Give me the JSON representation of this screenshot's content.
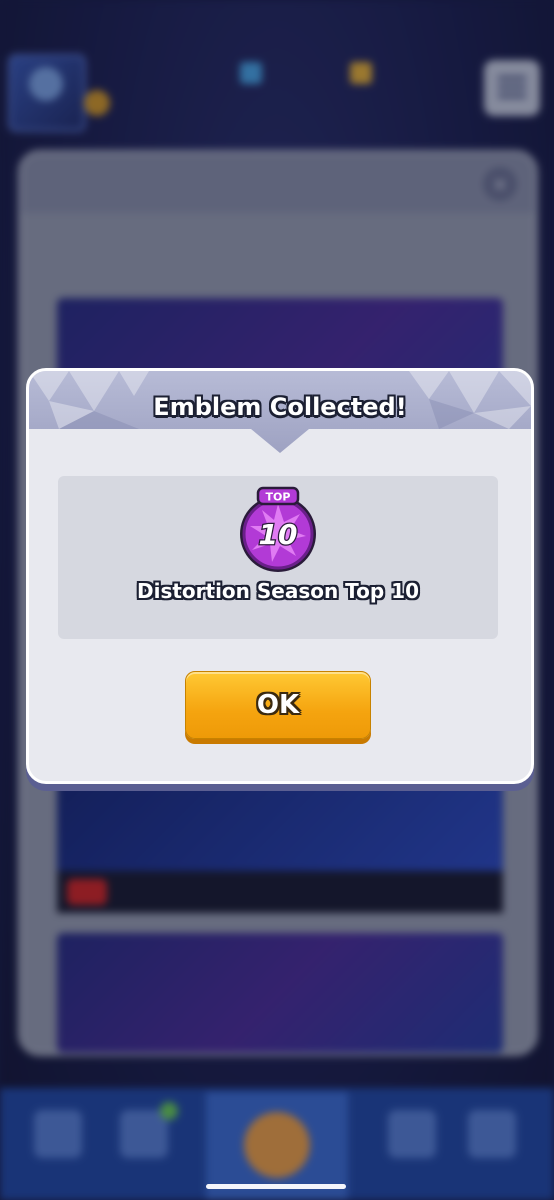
{
  "dialog": {
    "title": "Emblem Collected!",
    "emblem_name": "Distortion Season Top 10",
    "emblem_badge_label": "TOP",
    "emblem_badge_number": "10",
    "ok_label": "OK"
  },
  "colors": {
    "modal_bg": "#e8e9ef",
    "content_box": "#d6d8e0",
    "ok_button": "#f5a40f",
    "emblem_purple": "#b23ad6"
  }
}
